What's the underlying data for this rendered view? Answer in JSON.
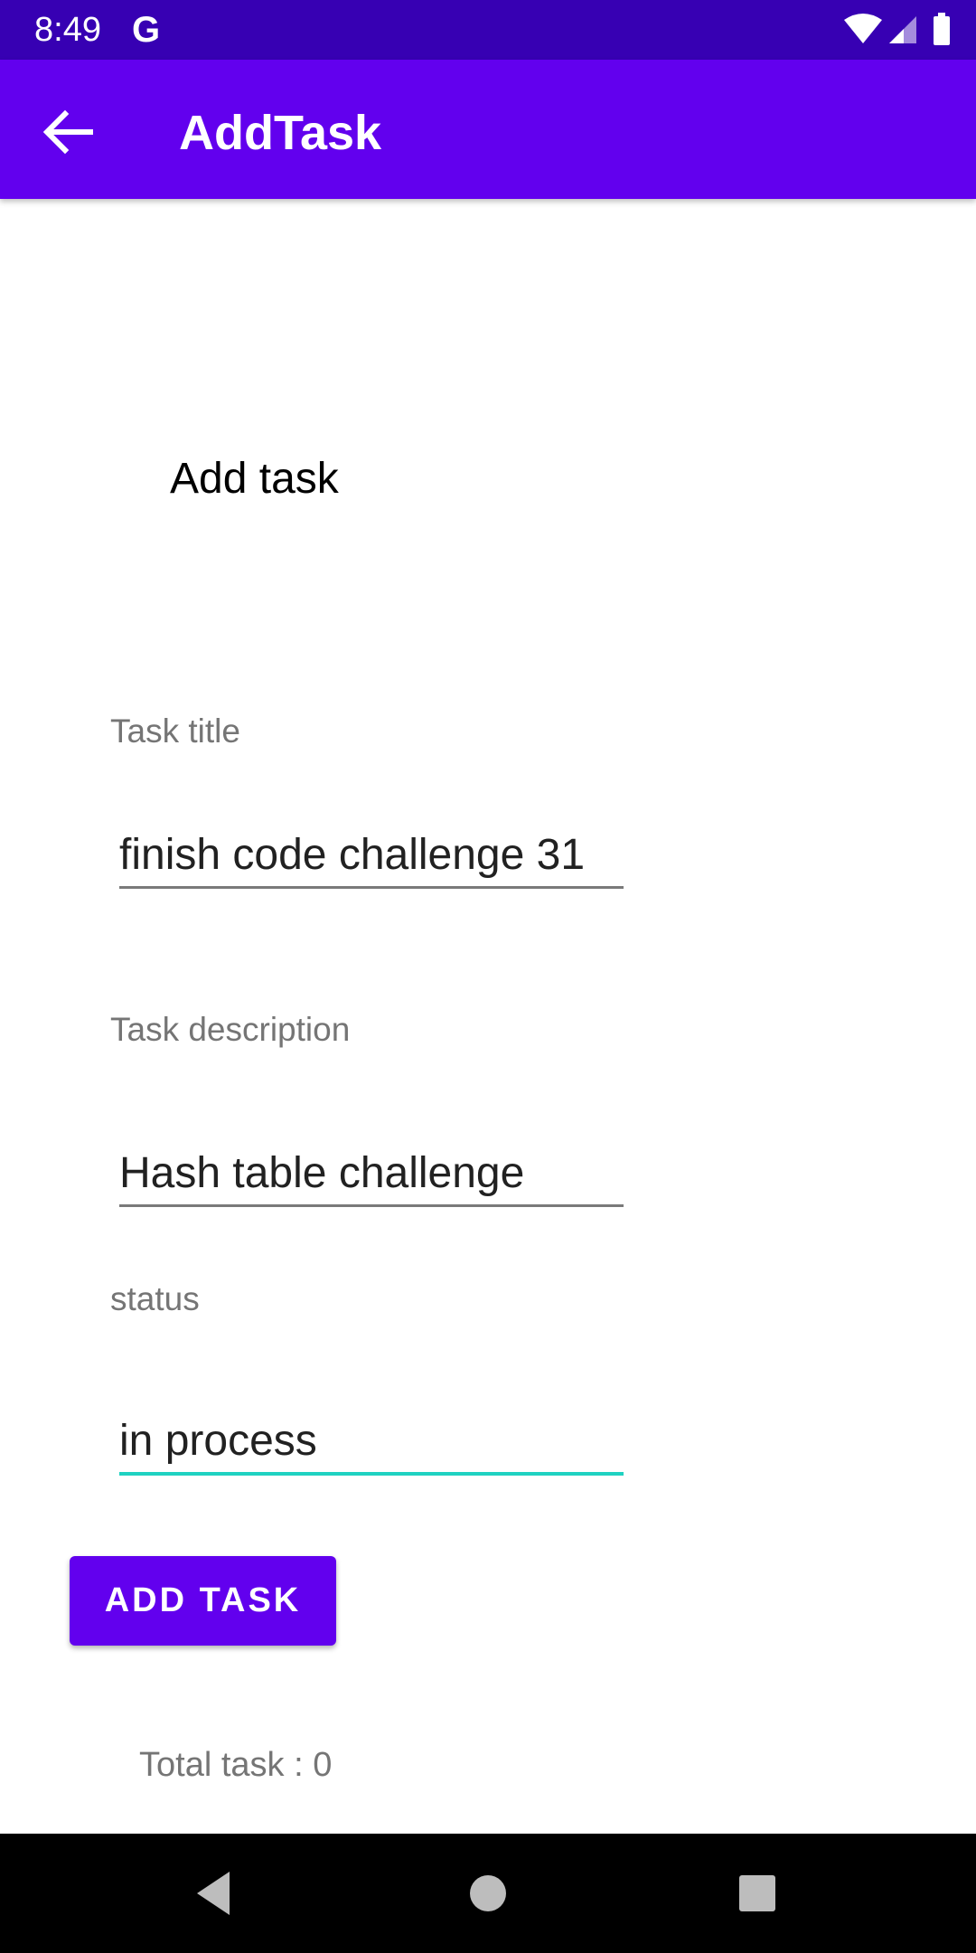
{
  "status_bar": {
    "time": "8:49",
    "notification_letter": "G",
    "icons": [
      "wifi-icon",
      "cell-signal-icon",
      "battery-icon"
    ]
  },
  "app_bar": {
    "title": "AddTask",
    "back_icon": "arrow-back-icon",
    "color": "#6200ee"
  },
  "heading": "Add task",
  "form": {
    "title_label": "Task title",
    "title_value": "finish code challenge 31",
    "description_label": "Task  description",
    "description_value": "Hash table challenge",
    "status_label": "status",
    "status_value": "in process",
    "focus_color": "#1fd2c1"
  },
  "add_button_label": "ADD TASK",
  "total_text": "Total task : 0",
  "nav_bar": {
    "icons": [
      "back-triangle-icon",
      "home-circle-icon",
      "recents-square-icon"
    ]
  }
}
